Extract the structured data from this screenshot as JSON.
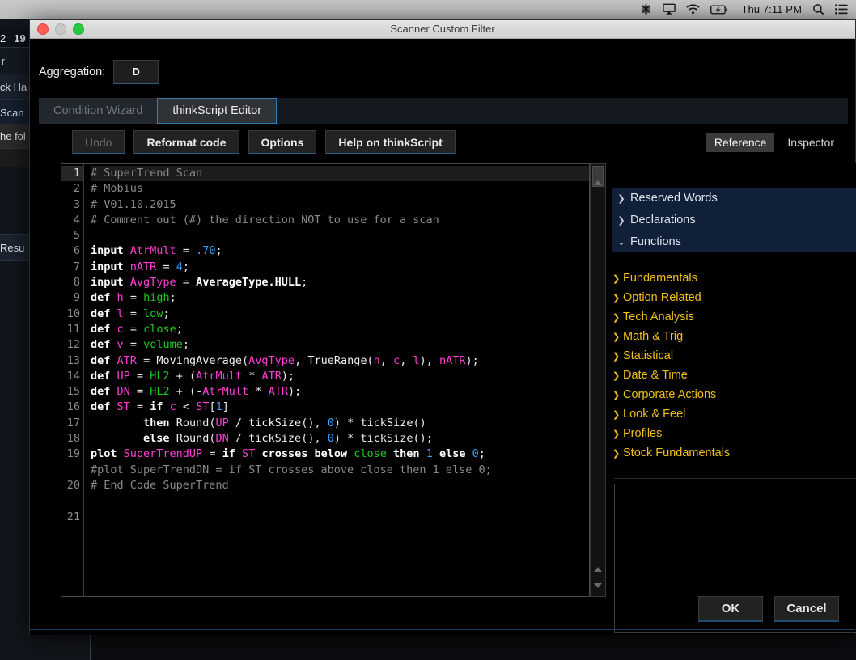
{
  "menubar": {
    "icons": [
      {
        "name": "app-status-icon",
        "glyph": "bluetooth-cluster"
      },
      {
        "name": "airplay-display-icon",
        "glyph": "display"
      },
      {
        "name": "wifi-icon",
        "glyph": "wifi"
      },
      {
        "name": "battery-charging-icon",
        "glyph": "battery"
      }
    ],
    "clock": "Thu 7:11 PM",
    "search_icon": "search-icon",
    "list_icon": "notification-center-icon"
  },
  "background_app": {
    "row1_left": "2",
    "row1_bold": "19",
    "row2_left": "r",
    "row3": "ck Ha",
    "row4": "Scan",
    "row5": "he fol",
    "row7": "Resu"
  },
  "window": {
    "title": "Scanner Custom Filter",
    "traffic_lights": [
      "close",
      "minimize",
      "zoom"
    ]
  },
  "aggregation": {
    "label": "Aggregation:",
    "value": "D"
  },
  "tabs": [
    {
      "id": "condition-wizard",
      "label": "Condition Wizard",
      "active": false
    },
    {
      "id": "thinkscript-editor",
      "label": "thinkScript Editor",
      "active": true
    }
  ],
  "toolbar": {
    "undo": "Undo",
    "reformat": "Reformat code",
    "options": "Options",
    "help": "Help on thinkScript"
  },
  "right_tabs": [
    {
      "id": "reference",
      "label": "Reference",
      "selected": true
    },
    {
      "id": "inspector",
      "label": "Inspector",
      "selected": false
    }
  ],
  "editor": {
    "line_numbers": [
      "1",
      "2",
      "3",
      "4",
      "5",
      "6",
      "7",
      "8",
      "9",
      "10",
      "11",
      "12",
      "13",
      "14",
      "15",
      "16",
      "17",
      "18",
      "19",
      "20",
      "21"
    ],
    "active_line": 1,
    "lines": [
      "# SuperTrend Scan",
      "# Mobius",
      "# V01.10.2015",
      "# Comment out (#) the direction NOT to use for a scan",
      "",
      "input AtrMult = .70;",
      "input nATR = 4;",
      "input AvgType = AverageType.HULL;",
      "def h = high;",
      "def l = low;",
      "def c = close;",
      "def v = volume;",
      "def ATR = MovingAverage(AvgType, TrueRange(h, c, l), nATR);",
      "def UP = HL2 + (AtrMult * ATR);",
      "def DN = HL2 + (-AtrMult * ATR);",
      "def ST = if c < ST[1]",
      "        then Round(UP / tickSize(), 0) * tickSize()",
      "        else Round(DN / tickSize(), 0) * tickSize();",
      "plot SuperTrendUP = if ST crosses below close then 1 else 0;",
      "#plot SuperTrendDN = if ST crosses above close then 1 else 0;",
      "# End Code SuperTrend"
    ]
  },
  "reference": {
    "groups": [
      {
        "label": "Reserved Words",
        "expanded": false,
        "chevron": "❯"
      },
      {
        "label": "Declarations",
        "expanded": false,
        "chevron": "❯"
      },
      {
        "label": "Functions",
        "expanded": true,
        "chevron": "⌄"
      }
    ],
    "categories": [
      {
        "label": "Fundamentals"
      },
      {
        "label": "Option Related"
      },
      {
        "label": "Tech Analysis"
      },
      {
        "label": "Math & Trig"
      },
      {
        "label": "Statistical"
      },
      {
        "label": "Date & Time"
      },
      {
        "label": "Corporate Actions"
      },
      {
        "label": "Look & Feel"
      },
      {
        "label": "Profiles"
      },
      {
        "label": "Stock Fundamentals"
      }
    ],
    "category_chevron": "❯",
    "description": ""
  },
  "footer": {
    "ok": "OK",
    "cancel": "Cancel"
  },
  "colors": {
    "accent_blue": "#2f7fb5",
    "tree_gold": "#f0c01b",
    "tree_group_bg": "#0f2038",
    "comment": "#8a8a8a",
    "variable_pink": "#ff3fd4",
    "number_blue": "#3aa0ff",
    "builtin_green": "#1ec81e"
  }
}
